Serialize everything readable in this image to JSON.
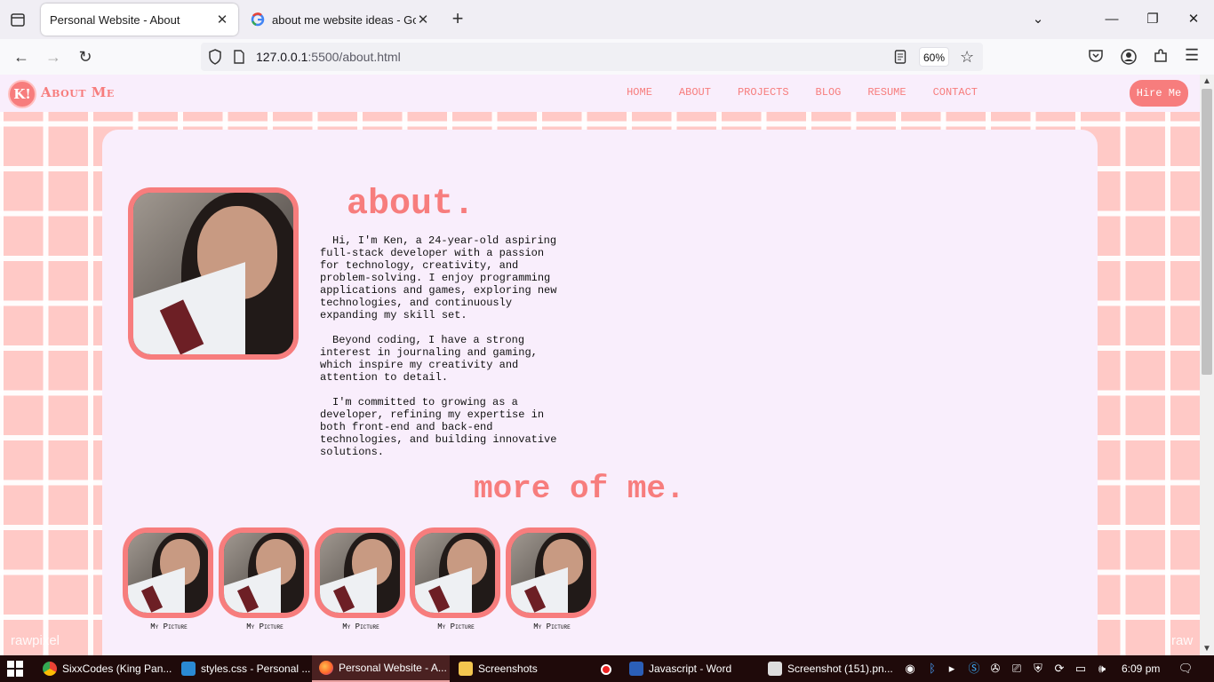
{
  "browser": {
    "tabs": [
      {
        "title": "Personal Website - About",
        "active": true,
        "icon": "page-icon"
      },
      {
        "title": "about me website ideas - Googl",
        "active": false,
        "icon": "google-icon"
      }
    ],
    "url_host": "127.0.0.1",
    "url_path": ":5500/about.html",
    "zoom": "60%"
  },
  "site": {
    "logo_text": "K!",
    "brand": "About Me",
    "nav": [
      "HOME",
      "ABOUT",
      "PROJECTS",
      "BLOG",
      "RESUME",
      "CONTACT"
    ],
    "hire_label": "Hire Me",
    "about_title": "about.",
    "paragraphs": [
      "Hi, I'm Ken, a 24-year-old aspiring full-stack developer with a passion for technology, creativity, and problem-solving. I enjoy programming applications and games, exploring new technologies, and continuously expanding my skill set.",
      "Beyond coding, I have a strong interest in journaling and gaming, which inspire my creativity and attention to detail.",
      "I'm committed to growing as a developer, refining my expertise in both front-end and back-end technologies, and building innovative solutions."
    ],
    "more_title": "more of me.",
    "gallery": [
      {
        "caption": "My Picture"
      },
      {
        "caption": "My Picture"
      },
      {
        "caption": "My Picture"
      },
      {
        "caption": "My Picture"
      },
      {
        "caption": "My Picture"
      }
    ],
    "watermark": "rawpixel",
    "watermark_right": "raw"
  },
  "taskbar": {
    "items": [
      {
        "label": "SixxCodes (King Pan...",
        "icon": "chrome-icon"
      },
      {
        "label": "styles.css - Personal ...",
        "icon": "vscode-icon"
      },
      {
        "label": "Personal Website - A...",
        "icon": "firefox-icon",
        "active": true
      },
      {
        "label": "Screenshots",
        "icon": "folder-icon"
      },
      {
        "label": "Javascript - Word",
        "icon": "word-icon"
      },
      {
        "label": "Screenshot (151).pn...",
        "icon": "photos-icon"
      }
    ],
    "time": "6:09 pm"
  },
  "colors": {
    "accent": "#f77d7d",
    "card": "#f9eefc",
    "grid": "#ffc9c6",
    "taskbar": "#1f0a0a"
  }
}
